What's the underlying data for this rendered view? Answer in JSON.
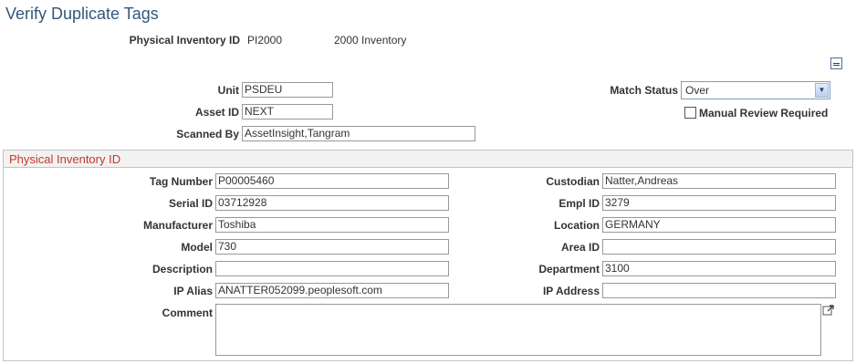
{
  "page": {
    "title": "Verify Duplicate Tags"
  },
  "header": {
    "physical_inventory_id_label": "Physical Inventory ID",
    "physical_inventory_id": "PI2000",
    "physical_inventory_descr": "2000 Inventory"
  },
  "form": {
    "unit_label": "Unit",
    "unit_value": "PSDEU",
    "asset_id_label": "Asset ID",
    "asset_id_value": "NEXT",
    "scanned_by_label": "Scanned By",
    "scanned_by_value": "AssetInsight,Tangram",
    "match_status_label": "Match Status",
    "match_status_value": "Over",
    "manual_review_label": "Manual Review Required",
    "manual_review_checked": false
  },
  "section": {
    "title": "Physical Inventory ID",
    "tag_number_label": "Tag Number",
    "tag_number_value": "P00005460",
    "serial_id_label": "Serial ID",
    "serial_id_value": "03712928",
    "manufacturer_label": "Manufacturer",
    "manufacturer_value": "Toshiba",
    "model_label": "Model",
    "model_value": "730",
    "description_label": "Description",
    "description_value": "",
    "ip_alias_label": "IP Alias",
    "ip_alias_value": "ANATTER052099.peoplesoft.com",
    "comment_label": "Comment",
    "comment_value": "",
    "custodian_label": "Custodian",
    "custodian_value": "Natter,Andreas",
    "empl_id_label": "Empl ID",
    "empl_id_value": "3279",
    "location_label": "Location",
    "location_value": "GERMANY",
    "area_id_label": "Area ID",
    "area_id_value": "",
    "department_label": "Department",
    "department_value": "3100",
    "ip_address_label": "IP Address",
    "ip_address_value": ""
  },
  "icons": {
    "collapse": "collapse-minus-icon",
    "dropdown": "chevron-down-icon",
    "expand": "expand-window-icon"
  },
  "colors": {
    "title": "#33577b",
    "section_title": "#c0392b",
    "border": "#999999"
  }
}
